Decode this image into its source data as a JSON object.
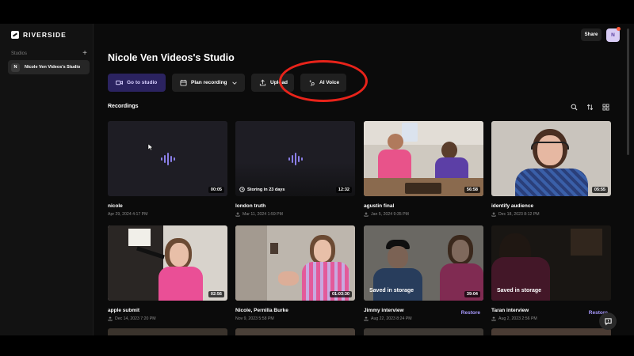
{
  "sidebar": {
    "logo": "RIVERSIDE",
    "section_label": "Studios",
    "add_label": "+",
    "studio": {
      "initial": "N",
      "name": "Nicole Ven Videos's Studio"
    }
  },
  "header": {
    "share_label": "Share",
    "user_initial": "N"
  },
  "main": {
    "title": "Nicole Ven Videos's Studio",
    "actions": [
      {
        "label": "Go to studio",
        "icon": "video-camera-icon"
      },
      {
        "label": "Plan recording",
        "icon": "calendar-icon"
      },
      {
        "label": "Upload",
        "icon": "upload-icon"
      },
      {
        "label": "AI Voice",
        "icon": "sparkle-voice-icon"
      }
    ],
    "recordings_label": "Recordings"
  },
  "recordings": [
    {
      "title": "nicole",
      "date": "Apr 29, 2024 4:17 PM",
      "duration": "00:05"
    },
    {
      "title": "london truth",
      "date": "Mar 11, 2024 1:59 PM",
      "duration": "12:32",
      "storing": "Storing in 23 days"
    },
    {
      "title": "agustin final",
      "date": "Jan 5, 2024 9:35 PM",
      "duration": "56:58"
    },
    {
      "title": "identify audience",
      "date": "Dec 18, 2023 8:12 PM",
      "duration": "05:55"
    },
    {
      "title": "apple submit",
      "date": "Dec 14, 2023 7:20 PM",
      "duration": "02:56"
    },
    {
      "title": "Nicole, Pernilla Burke",
      "date": "Nov 9, 2023 5:58 PM",
      "duration": "01:03:30"
    },
    {
      "title": "Jimmy interview",
      "date": "Aug 22, 2023 8:24 PM",
      "duration": "39:04",
      "saved": "Saved in storage",
      "restore": "Restore"
    },
    {
      "title": "Taran interview",
      "date": "Aug 2, 2023 2:56 PM",
      "saved": "Saved in storage",
      "restore": "Restore"
    }
  ],
  "colors": {
    "accent": "#a99bff",
    "primary_button": "#2b2360",
    "highlight": "#e8231a"
  }
}
